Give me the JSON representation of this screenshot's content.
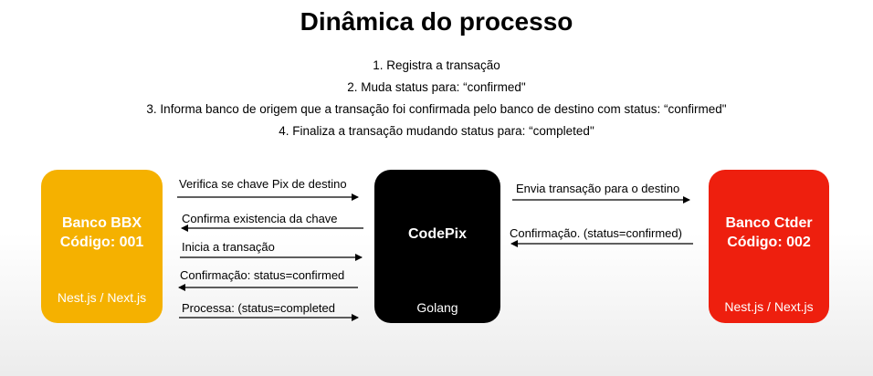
{
  "title": "Dinâmica do processo",
  "steps": [
    "1. Registra a transação",
    "2. Muda status para: “confirmed\"",
    "3. Informa banco de origem que a transação foi confirmada pelo banco de destino com status: “confirmed\"",
    "4. Finaliza a transação mudando status para: “completed\""
  ],
  "nodes": {
    "bbx": {
      "name_line1": "Banco BBX",
      "name_line2": "Código: 001",
      "tech": "Nest.js / Next.js",
      "color": "#f5b100"
    },
    "codepix": {
      "name": "CodePix",
      "tech": "Golang",
      "color": "#000000"
    },
    "ctder": {
      "name_line1": "Banco Ctder",
      "name_line2": "Código: 002",
      "tech": "Nest.js / Next.js",
      "color": "#ee1f0e"
    }
  },
  "left_flows": [
    {
      "label": "Verifica se chave Pix de destino",
      "direction": "right"
    },
    {
      "label": "Confirma existencia da chave",
      "direction": "left"
    },
    {
      "label": "Inicia a transação",
      "direction": "right"
    },
    {
      "label": "Confirmação: status=confirmed",
      "direction": "left"
    },
    {
      "label": "Processa: (status=completed",
      "direction": "right"
    }
  ],
  "right_flows": [
    {
      "label": "Envia transação para o destino",
      "direction": "right"
    },
    {
      "label": "Confirmação. (status=confirmed)",
      "direction": "left"
    }
  ]
}
